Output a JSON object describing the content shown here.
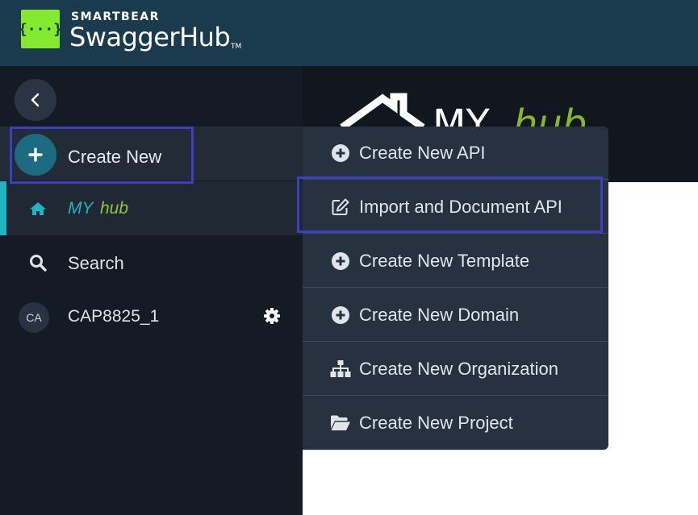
{
  "header": {
    "logo_glyph": "{···}",
    "brand_company": "SMARTBEAR",
    "brand_product": "SwaggerHub",
    "brand_tm": "TM"
  },
  "banner": {
    "my": "MY",
    "hub": "hub"
  },
  "sidebar": {
    "back_icon": "chevron-left-icon",
    "create_new": {
      "label": "Create New",
      "icon": "plus-icon"
    },
    "items": [
      {
        "label_my": "MY",
        "label_hub": "hub",
        "icon": "home-icon",
        "active": true
      },
      {
        "label": "Search",
        "icon": "search-icon"
      },
      {
        "avatar": "CA",
        "label": "CAP8825_1",
        "icon": "gear-icon"
      }
    ]
  },
  "create_menu": {
    "items": [
      {
        "label": "Create New API",
        "icon": "plus-circle-icon"
      },
      {
        "label": "Import and Document API",
        "icon": "edit-icon",
        "highlighted": true
      },
      {
        "label": "Create New Template",
        "icon": "plus-circle-icon"
      },
      {
        "label": "Create New Domain",
        "icon": "plus-circle-icon"
      },
      {
        "label": "Create New Organization",
        "icon": "sitemap-icon"
      },
      {
        "label": "Create New Project",
        "icon": "folder-open-icon"
      }
    ]
  },
  "colors": {
    "header_bg": "#1a3a4d",
    "logo_green": "#85ea2d",
    "sidebar_bg": "#151b24",
    "menu_bg": "#273240",
    "accent_teal": "#1fb6c4",
    "accent_green": "#8cc63f",
    "highlight_border": "#3d3fc2"
  }
}
